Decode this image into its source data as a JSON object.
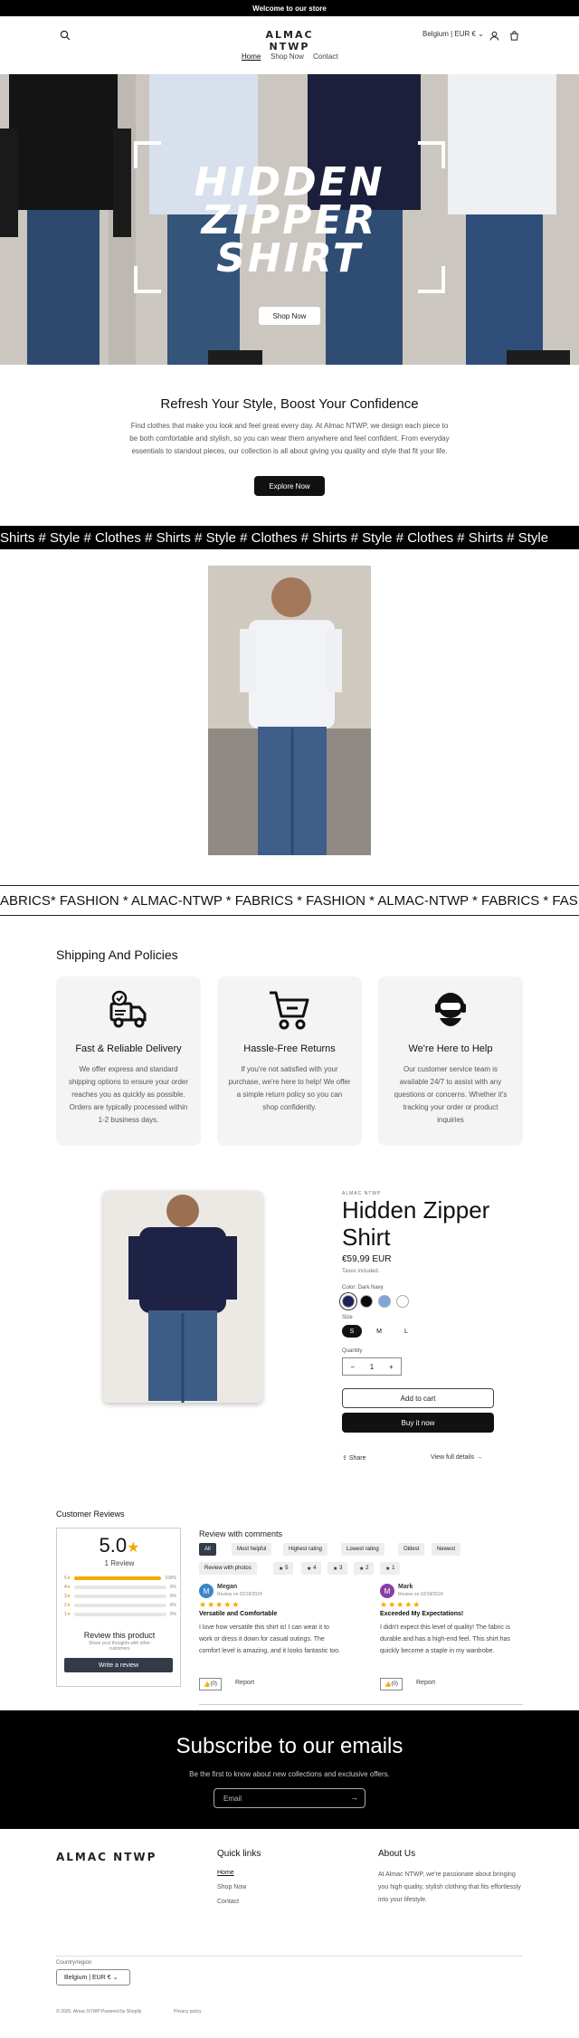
{
  "announcement": "Welcome to our store",
  "header": {
    "logo": "ALMAC NTWP",
    "country": "Belgium | EUR €",
    "nav": [
      "Home",
      "Shop Now",
      "Contact"
    ]
  },
  "hero": {
    "title_lines": [
      "HIDDEN",
      "ZIPPER",
      "SHIRT"
    ],
    "button": "Shop Now"
  },
  "intro": {
    "title": "Refresh Your Style, Boost Your Confidence",
    "text": "Find clothes that make you look and feel great every day. At Almac NTWP, we design each piece to be both comfortable and stylish, so you can wear them anywhere and feel confident. From everyday essentials to standout pieces, our collection is all about giving you quality and style that fit your life.",
    "button": "Explore Now"
  },
  "marquee1": "Shirts # Style # Clothes # Shirts # Style # Clothes # Shirts # Style  # Clothes # Shirts # Style",
  "marquee2": "ABRICS* FASHION * ALMAC-NTWP * FABRICS * FASHION * ALMAC-NTWP * FABRICS * FASHION",
  "shipping": {
    "title": "Shipping And Policies",
    "cards": [
      {
        "icon": "delivery-truck-icon",
        "title": "Fast & Reliable Delivery",
        "text": "We offer express and standard shipping options to ensure your order reaches you as quickly as possible. Orders are typically processed within 1-2 business days."
      },
      {
        "icon": "shopping-cart-icon",
        "title": "Hassle-Free Returns",
        "text": "If you're not satisfied with your purchase, we're here to help! We offer a simple return policy so you can shop confidently."
      },
      {
        "icon": "headset-support-icon",
        "title": "We're Here to Help",
        "text": "Our customer service team is available 24/7 to assist with any questions or concerns. Whether it's tracking your order or product inquiries"
      }
    ]
  },
  "product": {
    "brand": "ALMAC NTWP",
    "title": "Hidden Zipper Shirt",
    "price": "€59,99 EUR",
    "taxes": "Taxes included.",
    "color_label": "Color: Dark Navy",
    "colors": [
      "#1e2156",
      "#0a0a0a",
      "#7ea6d9",
      "#ffffff"
    ],
    "size_label": "Size",
    "sizes": [
      "S",
      "M",
      "L"
    ],
    "quantity_label": "Quantity",
    "quantity": "1",
    "add_to_cart": "Add to cart",
    "buy_now": "Buy it now",
    "share": "Share",
    "view_details": "View full details"
  },
  "reviews": {
    "heading": "Customer Reviews",
    "score": "5.0",
    "count": "1 Review",
    "bars": [
      {
        "stars": "5",
        "pct": "100%",
        "fill": 1.0
      },
      {
        "stars": "4",
        "pct": "0%",
        "fill": 0
      },
      {
        "stars": "3",
        "pct": "0%",
        "fill": 0
      },
      {
        "stars": "2",
        "pct": "0%",
        "fill": 0
      },
      {
        "stars": "1",
        "pct": "0%",
        "fill": 0
      }
    ],
    "review_product": "Review this product",
    "share_note": "Share your thoughts with other customers",
    "write_review": "Write a review",
    "with_comments": "Review with comments",
    "filters": [
      "All",
      "Most helpful",
      "Highest rating",
      "Lowest rating",
      "Oldest",
      "Newest"
    ],
    "photo_filters": [
      "Review with photos",
      "5",
      "4",
      "3",
      "2",
      "1"
    ],
    "items": [
      {
        "initial": "M",
        "name": "Megan",
        "date": "Review on 02/18/2024",
        "title": "Versatile and Comfortable",
        "text": "I love how versatile this shirt is! I can wear it to work or dress it down for casual outings. The comfort level is amazing, and it looks fantastic too.",
        "likes": "(0)",
        "report": "Report",
        "color": "#3a86c8"
      },
      {
        "initial": "M",
        "name": "Mark",
        "date": "Review on 02/18/2024",
        "title": "Exceeded My Expectations!",
        "text": "I didn't expect this level of quality! The fabric is durable and has a high-end feel. This shirt has quickly become a staple in my wardrobe.",
        "likes": "(0)",
        "report": "Report",
        "color": "#8a3fa8"
      }
    ]
  },
  "subscribe": {
    "title": "Subscribe to our emails",
    "text": "Be the first to know about new collections and exclusive offers.",
    "placeholder": "Email"
  },
  "footer": {
    "logo": "ALMAC NTWP",
    "quick_links_title": "Quick links",
    "links": [
      "Home",
      "Shop Now",
      "Contact"
    ],
    "about_title": "About Us",
    "about_text": "At Almac NTWP, we're passionate about bringing you high-quality, stylish clothing that fits effortlessly into your lifestyle.",
    "country_label": "Country/region",
    "country": "Belgium | EUR €",
    "copyright": "© 2025, Almac NTWP Powered by Shopify",
    "privacy": "Privacy policy"
  }
}
